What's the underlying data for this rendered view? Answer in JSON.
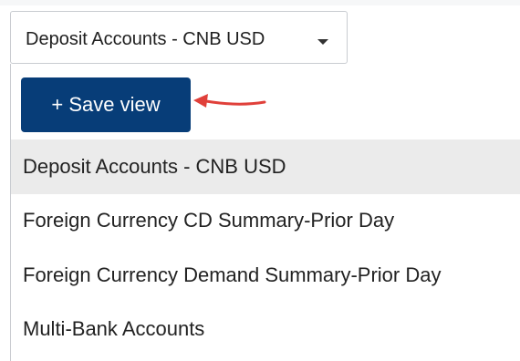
{
  "select": {
    "value": "Deposit Accounts - CNB USD",
    "caret_icon": "caret-down-icon"
  },
  "menu": {
    "save_view_label": "+ Save view",
    "annotation_icon": "red-arrow-icon",
    "annotation_color": "#e0403a",
    "options": [
      {
        "label": "Deposit Accounts - CNB USD",
        "selected": true
      },
      {
        "label": "Foreign Currency CD Summary-Prior Day",
        "selected": false
      },
      {
        "label": "Foreign Currency Demand Summary-Prior Day",
        "selected": false
      },
      {
        "label": "Multi-Bank Accounts",
        "selected": false
      }
    ]
  },
  "colors": {
    "button_bg": "#073d78",
    "selected_row_bg": "#ebebeb",
    "border": "#c9ccd1"
  }
}
